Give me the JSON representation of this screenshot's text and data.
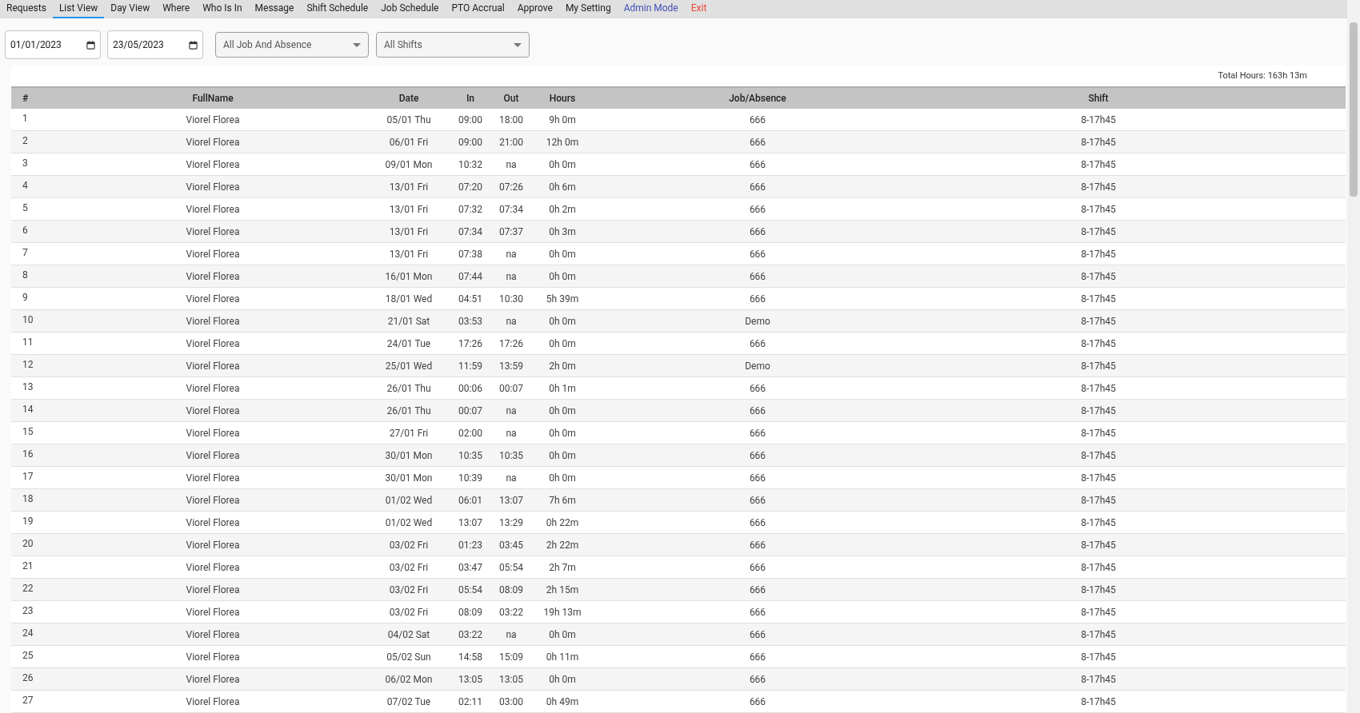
{
  "nav": [
    {
      "label": "Requests",
      "selected": false,
      "kind": "tab"
    },
    {
      "label": "List View",
      "selected": true,
      "kind": "tab"
    },
    {
      "label": "Day View",
      "selected": false,
      "kind": "tab"
    },
    {
      "label": "Where",
      "selected": false,
      "kind": "tab"
    },
    {
      "label": "Who Is In",
      "selected": false,
      "kind": "tab"
    },
    {
      "label": "Message",
      "selected": false,
      "kind": "tab"
    },
    {
      "label": "Shift Schedule",
      "selected": false,
      "kind": "tab"
    },
    {
      "label": "Job Schedule",
      "selected": false,
      "kind": "tab"
    },
    {
      "label": "PTO Accrual",
      "selected": false,
      "kind": "tab"
    },
    {
      "label": "Approve",
      "selected": false,
      "kind": "tab"
    },
    {
      "label": "My Setting",
      "selected": false,
      "kind": "tab"
    },
    {
      "label": "Admin Mode",
      "selected": false,
      "kind": "admin"
    },
    {
      "label": "Exit",
      "selected": false,
      "kind": "exit"
    }
  ],
  "filters": {
    "start_date": "01/01/2023",
    "end_date": "23/05/2023",
    "job_select": "All Job And Absence",
    "shift_select": "All Shifts"
  },
  "total_hours": "Total Hours: 163h 13m",
  "table": {
    "columns": [
      "#",
      "FullName",
      "Date",
      "In",
      "Out",
      "Hours",
      "Job/Absence",
      "Shift"
    ],
    "rows": [
      [
        "1",
        "Viorel Florea",
        "05/01 Thu",
        "09:00",
        "18:00",
        "9h 0m",
        "666",
        "8-17h45"
      ],
      [
        "2",
        "Viorel Florea",
        "06/01 Fri",
        "09:00",
        "21:00",
        "12h 0m",
        "666",
        "8-17h45"
      ],
      [
        "3",
        "Viorel Florea",
        "09/01 Mon",
        "10:32",
        "na",
        "0h 0m",
        "666",
        "8-17h45"
      ],
      [
        "4",
        "Viorel Florea",
        "13/01 Fri",
        "07:20",
        "07:26",
        "0h 6m",
        "666",
        "8-17h45"
      ],
      [
        "5",
        "Viorel Florea",
        "13/01 Fri",
        "07:32",
        "07:34",
        "0h 2m",
        "666",
        "8-17h45"
      ],
      [
        "6",
        "Viorel Florea",
        "13/01 Fri",
        "07:34",
        "07:37",
        "0h 3m",
        "666",
        "8-17h45"
      ],
      [
        "7",
        "Viorel Florea",
        "13/01 Fri",
        "07:38",
        "na",
        "0h 0m",
        "666",
        "8-17h45"
      ],
      [
        "8",
        "Viorel Florea",
        "16/01 Mon",
        "07:44",
        "na",
        "0h 0m",
        "666",
        "8-17h45"
      ],
      [
        "9",
        "Viorel Florea",
        "18/01 Wed",
        "04:51",
        "10:30",
        "5h 39m",
        "666",
        "8-17h45"
      ],
      [
        "10",
        "Viorel Florea",
        "21/01 Sat",
        "03:53",
        "na",
        "0h 0m",
        "Demo",
        "8-17h45"
      ],
      [
        "11",
        "Viorel Florea",
        "24/01 Tue",
        "17:26",
        "17:26",
        "0h 0m",
        "666",
        "8-17h45"
      ],
      [
        "12",
        "Viorel Florea",
        "25/01 Wed",
        "11:59",
        "13:59",
        "2h 0m",
        "Demo",
        "8-17h45"
      ],
      [
        "13",
        "Viorel Florea",
        "26/01 Thu",
        "00:06",
        "00:07",
        "0h 1m",
        "666",
        "8-17h45"
      ],
      [
        "14",
        "Viorel Florea",
        "26/01 Thu",
        "00:07",
        "na",
        "0h 0m",
        "666",
        "8-17h45"
      ],
      [
        "15",
        "Viorel Florea",
        "27/01 Fri",
        "02:00",
        "na",
        "0h 0m",
        "666",
        "8-17h45"
      ],
      [
        "16",
        "Viorel Florea",
        "30/01 Mon",
        "10:35",
        "10:35",
        "0h 0m",
        "666",
        "8-17h45"
      ],
      [
        "17",
        "Viorel Florea",
        "30/01 Mon",
        "10:39",
        "na",
        "0h 0m",
        "666",
        "8-17h45"
      ],
      [
        "18",
        "Viorel Florea",
        "01/02 Wed",
        "06:01",
        "13:07",
        "7h 6m",
        "666",
        "8-17h45"
      ],
      [
        "19",
        "Viorel Florea",
        "01/02 Wed",
        "13:07",
        "13:29",
        "0h 22m",
        "666",
        "8-17h45"
      ],
      [
        "20",
        "Viorel Florea",
        "03/02 Fri",
        "01:23",
        "03:45",
        "2h 22m",
        "666",
        "8-17h45"
      ],
      [
        "21",
        "Viorel Florea",
        "03/02 Fri",
        "03:47",
        "05:54",
        "2h 7m",
        "666",
        "8-17h45"
      ],
      [
        "22",
        "Viorel Florea",
        "03/02 Fri",
        "05:54",
        "08:09",
        "2h 15m",
        "666",
        "8-17h45"
      ],
      [
        "23",
        "Viorel Florea",
        "03/02 Fri",
        "08:09",
        "03:22",
        "19h 13m",
        "666",
        "8-17h45"
      ],
      [
        "24",
        "Viorel Florea",
        "04/02 Sat",
        "03:22",
        "na",
        "0h 0m",
        "666",
        "8-17h45"
      ],
      [
        "25",
        "Viorel Florea",
        "05/02 Sun",
        "14:58",
        "15:09",
        "0h 11m",
        "666",
        "8-17h45"
      ],
      [
        "26",
        "Viorel Florea",
        "06/02 Mon",
        "13:05",
        "13:05",
        "0h 0m",
        "666",
        "8-17h45"
      ],
      [
        "27",
        "Viorel Florea",
        "07/02 Tue",
        "02:11",
        "03:00",
        "0h 49m",
        "666",
        "8-17h45"
      ]
    ]
  }
}
